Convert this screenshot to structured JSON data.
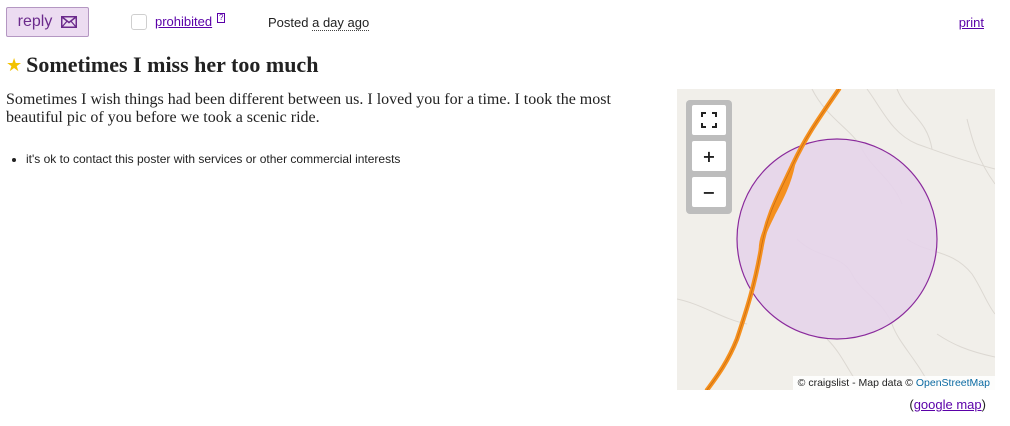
{
  "topbar": {
    "reply_label": "reply",
    "prohibited_label": "prohibited",
    "prohibited_help": "?",
    "posted_prefix": "Posted",
    "posted_time": "a day ago",
    "print_label": "print"
  },
  "posting": {
    "title": "Sometimes I miss her too much",
    "body": "Sometimes I wish things had been different between us. I loved you for a time. I took the most beautiful pic of you before we took a scenic ride.",
    "notices": [
      "it's ok to contact this poster with services or other commercial interests"
    ]
  },
  "map": {
    "zoom_controls": {
      "fullscreen": "⛶",
      "zoom_in": "+",
      "zoom_out": "−"
    },
    "attribution_prefix": "© craigslist - Map data ©",
    "attribution_link": "OpenStreetMap",
    "google_map_open": "(",
    "google_map_label": "google map",
    "google_map_close": ")"
  },
  "colors": {
    "accent": "#5a00a8",
    "reply_bg": "#ecdcf1",
    "road": "#f5901e",
    "radius_fill": "#e6d4ea",
    "radius_stroke": "#8a2a9c",
    "star": "#f2c200"
  },
  "icons": {
    "reply": "envelope-icon",
    "star": "star-icon",
    "fullscreen": "fullscreen-icon"
  }
}
